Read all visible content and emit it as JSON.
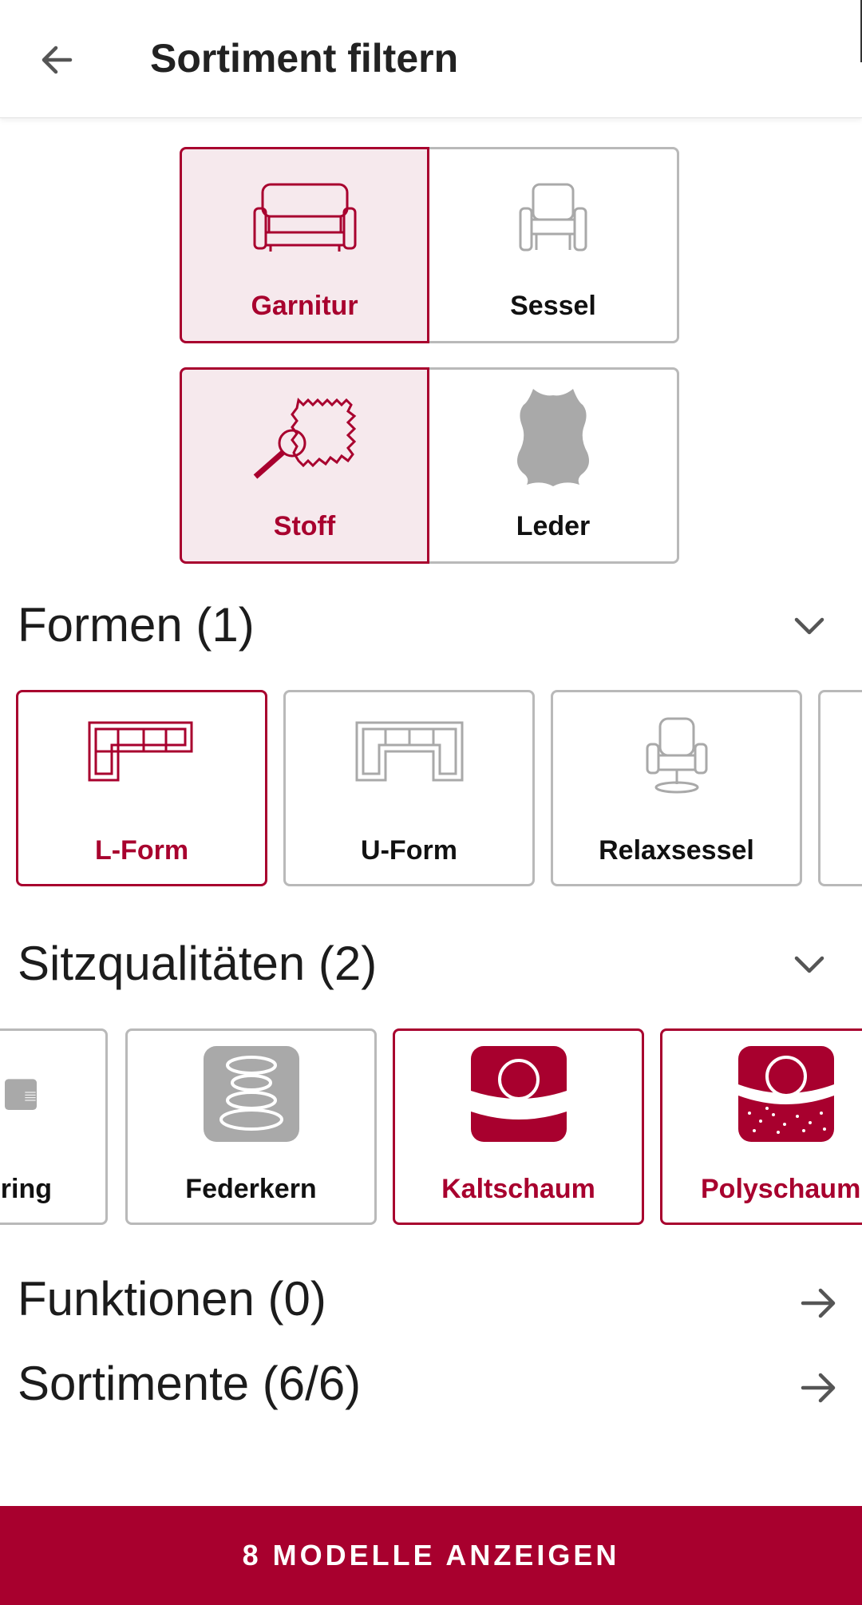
{
  "header": {
    "title": "Sortiment filtern",
    "back_icon": "arrow-left-icon"
  },
  "type_toggle": [
    {
      "label": "Garnitur",
      "icon": "sofa-icon",
      "selected": true
    },
    {
      "label": "Sessel",
      "icon": "armchair-icon",
      "selected": false
    }
  ],
  "material_toggle": [
    {
      "label": "Stoff",
      "icon": "fabric-swatch-icon",
      "selected": true
    },
    {
      "label": "Leder",
      "icon": "leather-hide-icon",
      "selected": false
    }
  ],
  "formen": {
    "title": "Formen (1)",
    "items": [
      {
        "label": "L-Form",
        "icon": "l-shape-sofa-icon",
        "selected": true
      },
      {
        "label": "U-Form",
        "icon": "u-shape-sofa-icon",
        "selected": false
      },
      {
        "label": "Relaxsessel",
        "icon": "recliner-icon",
        "selected": false
      }
    ]
  },
  "sitzqualitaeten": {
    "title": "Sitzqualitäten (2)",
    "items": [
      {
        "label": "ring",
        "icon": "pocket-spring-icon",
        "selected": false
      },
      {
        "label": "Federkern",
        "icon": "coil-spring-icon",
        "selected": false
      },
      {
        "label": "Kaltschaum",
        "icon": "cold-foam-icon",
        "selected": true
      },
      {
        "label": "Polyschaum",
        "icon": "poly-foam-icon",
        "selected": true
      }
    ]
  },
  "funktionen": {
    "label": "Funktionen (0)"
  },
  "sortimente": {
    "label": "Sortimente (6/6)"
  },
  "cta": {
    "label": "8 MODELLE ANZEIGEN"
  },
  "colors": {
    "accent": "#a8002e",
    "selected_bg": "#f6e9ed",
    "border": "#b9b9b9",
    "icon_gray": "#a9a9a9"
  }
}
